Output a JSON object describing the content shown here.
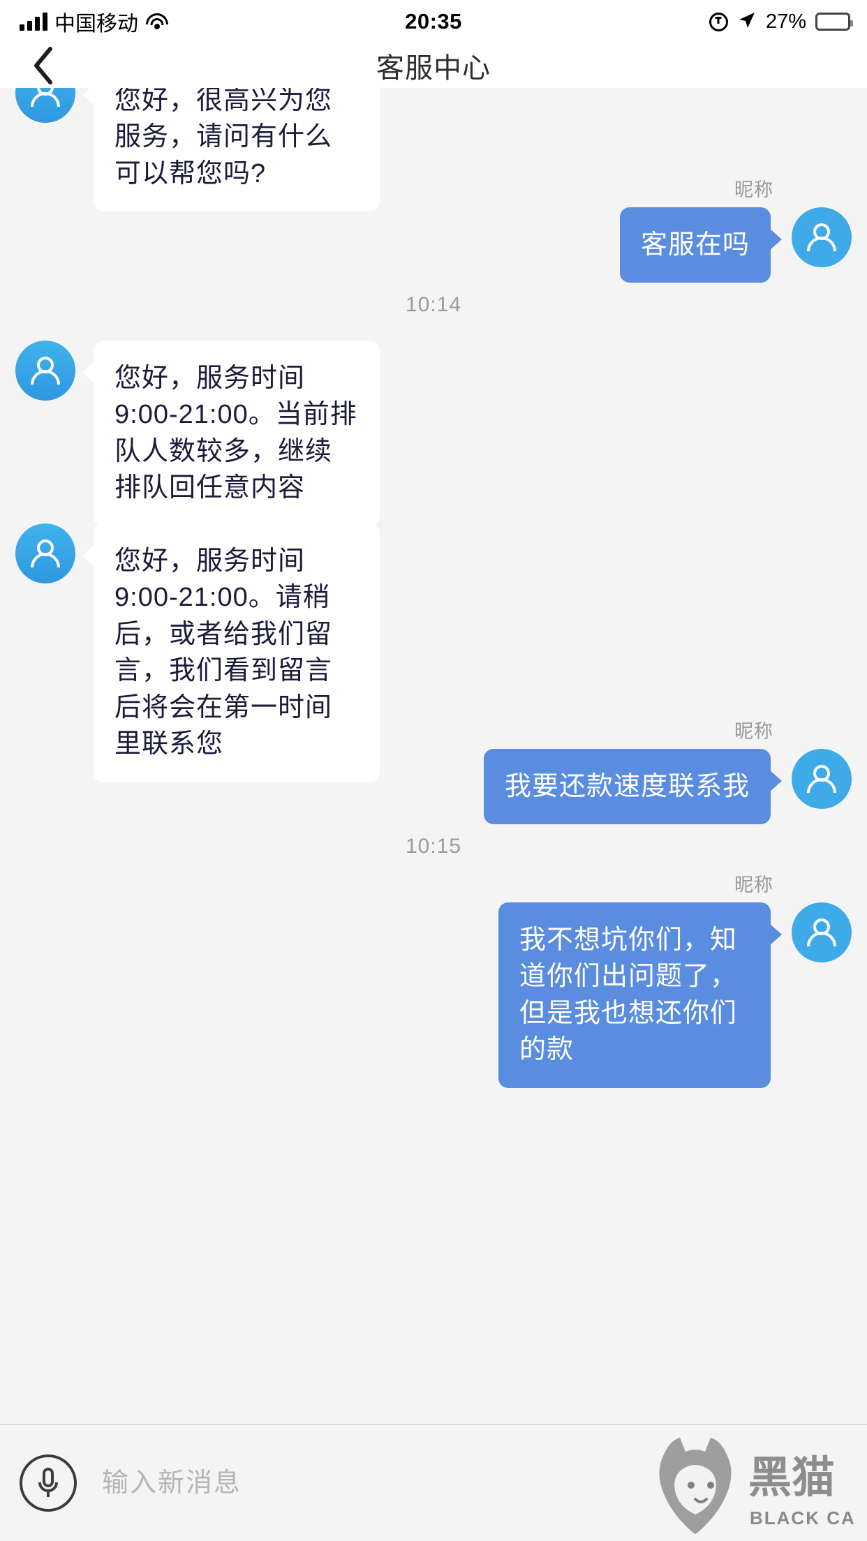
{
  "status_bar": {
    "carrier": "中国移动",
    "time": "20:35",
    "battery_percent": "27%",
    "signal_icon": "signal-bars-icon",
    "wifi_icon": "wifi-icon",
    "lock_icon": "rotation-lock-icon",
    "location_icon": "location-arrow-icon",
    "battery_icon": "battery-icon"
  },
  "navbar": {
    "title": "客服中心",
    "back_icon": "chevron-left-icon"
  },
  "chat": {
    "nickname_label": "昵称",
    "messages": [
      {
        "id": "m1",
        "sender": "agent",
        "text": "您好，很高兴为您服务，请问有什么可以帮您吗?",
        "avatar_icon": "agent-avatar-icon"
      },
      {
        "id": "m2",
        "sender": "user",
        "nickname": "昵称",
        "text": "客服在吗",
        "avatar_icon": "user-avatar-icon"
      },
      {
        "id": "t1",
        "sender": "timestamp",
        "text": "10:14"
      },
      {
        "id": "m3",
        "sender": "agent",
        "text": "您好，服务时间9:00-21:00。当前排队人数较多，继续排队回任意内容",
        "avatar_icon": "agent-avatar-icon"
      },
      {
        "id": "m4",
        "sender": "agent",
        "text": "您好，服务时间9:00-21:00。请稍后，或者给我们留言，我们看到留言后将会在第一时间里联系您",
        "avatar_icon": "agent-avatar-icon"
      },
      {
        "id": "m5",
        "sender": "user",
        "nickname": "昵称",
        "text": "我要还款速度联系我",
        "avatar_icon": "user-avatar-icon"
      },
      {
        "id": "t2",
        "sender": "timestamp",
        "text": "10:15"
      },
      {
        "id": "m6",
        "sender": "user",
        "nickname": "昵称",
        "text": "我不想坑你们，知道你们出问题了，但是我也想还你们的款",
        "avatar_icon": "user-avatar-icon"
      }
    ]
  },
  "input_bar": {
    "mic_icon": "microphone-icon",
    "placeholder": "输入新消息",
    "value": ""
  },
  "watermark": {
    "brand_cn": "黑猫",
    "brand_en": "BLACK CAT",
    "icon": "black-cat-logo-icon"
  },
  "colors": {
    "user_bubble": "#5a8ce0",
    "agent_bubble": "#ffffff",
    "avatar_blue": "#3eabe8",
    "chat_bg": "#f4f4f4",
    "text_dark": "#1b1b3a"
  }
}
